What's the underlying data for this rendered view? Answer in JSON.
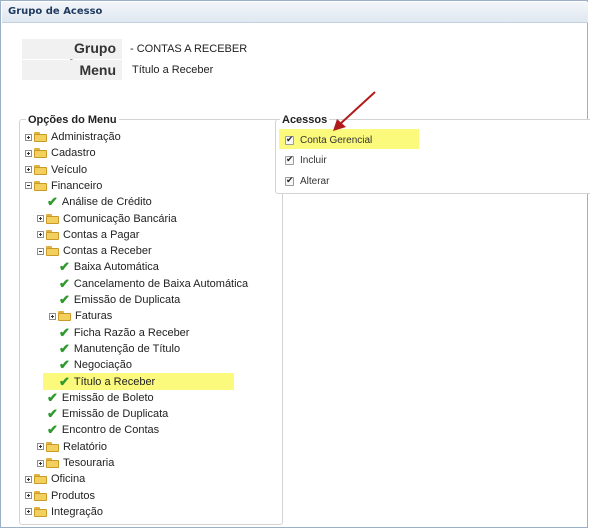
{
  "window": {
    "title": "Grupo de Acesso"
  },
  "header": {
    "grupo_label": "Grupo Acesso",
    "grupo_value": "- CONTAS A RECEBER",
    "menu_label": "Menu",
    "menu_value": "Título a Receber"
  },
  "menu_tree": {
    "legend": "Opções do Menu",
    "items": [
      {
        "label": "Administração",
        "type": "folder",
        "expander": "closed"
      },
      {
        "label": "Cadastro",
        "type": "folder",
        "expander": "closed"
      },
      {
        "label": "Veículo",
        "type": "folder",
        "expander": "closed"
      },
      {
        "label": "Financeiro",
        "type": "folder",
        "expander": "open"
      },
      {
        "label": "Análise de Crédito",
        "type": "check"
      },
      {
        "label": "Comunicação Bancária",
        "type": "folder",
        "expander": "closed"
      },
      {
        "label": "Contas a Pagar",
        "type": "folder",
        "expander": "closed"
      },
      {
        "label": "Contas a Receber",
        "type": "folder",
        "expander": "open"
      },
      {
        "label": "Baixa Automática",
        "type": "check"
      },
      {
        "label": "Cancelamento de Baixa Automática",
        "type": "check"
      },
      {
        "label": "Emissão de Duplicata",
        "type": "check"
      },
      {
        "label": "Faturas",
        "type": "folder",
        "expander": "closed"
      },
      {
        "label": "Ficha Razão a Receber",
        "type": "check"
      },
      {
        "label": "Manutenção de Título",
        "type": "check"
      },
      {
        "label": "Negociação",
        "type": "check"
      },
      {
        "label": "Título a Receber",
        "type": "check",
        "selected": true
      },
      {
        "label": "Emissão de Boleto",
        "type": "check"
      },
      {
        "label": "Emissão de Duplicata",
        "type": "check"
      },
      {
        "label": "Encontro de Contas",
        "type": "check"
      },
      {
        "label": "Relatório",
        "type": "folder",
        "expander": "closed"
      },
      {
        "label": "Tesouraria",
        "type": "folder",
        "expander": "closed"
      },
      {
        "label": "Oficina",
        "type": "folder",
        "expander": "closed"
      },
      {
        "label": "Produtos",
        "type": "folder",
        "expander": "closed"
      },
      {
        "label": "Integração",
        "type": "folder",
        "expander": "closed"
      }
    ]
  },
  "acessos": {
    "legend": "Acessos",
    "items": [
      {
        "label": "Conta Gerencial",
        "checked": true,
        "highlighted": true
      },
      {
        "label": "Incluir",
        "checked": true
      },
      {
        "label": "Alterar",
        "checked": true
      }
    ]
  },
  "colors": {
    "highlight": "#fbfa7c",
    "check_green": "#2e9a2e",
    "arrow": "#b01c1c"
  },
  "icons": {
    "folder": "folder-icon",
    "check": "check-icon",
    "expander": "expander-icon",
    "checkbox": "checkbox-icon",
    "annotation": "arrow-annotation-icon"
  }
}
